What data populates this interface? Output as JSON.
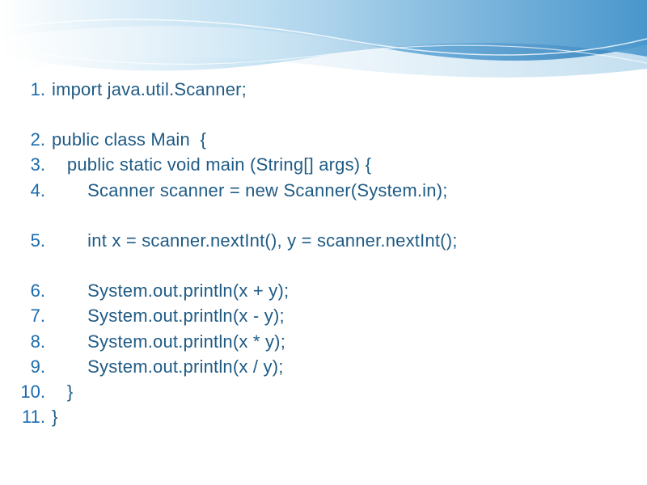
{
  "code_lines": [
    {
      "num": "1.",
      "text": "import java.util.Scanner;",
      "indent": 0
    },
    {
      "num": "",
      "text": "",
      "indent": 0,
      "blank": true
    },
    {
      "num": "2.",
      "text": "public class Main  {",
      "indent": 0
    },
    {
      "num": "3.",
      "text": "   public static void main (String[] args) {",
      "indent": 0
    },
    {
      "num": "4.",
      "text": "       Scanner scanner = new Scanner(System.in);",
      "indent": 0
    },
    {
      "num": "",
      "text": "",
      "indent": 0,
      "blank": true
    },
    {
      "num": "5.",
      "text": "       int x = scanner.nextInt(), y = scanner.nextInt();",
      "indent": 0
    },
    {
      "num": "",
      "text": "",
      "indent": 0,
      "blank": true
    },
    {
      "num": "6.",
      "text": "       System.out.println(x + y);",
      "indent": 0
    },
    {
      "num": "7.",
      "text": "       System.out.println(x - y);",
      "indent": 0
    },
    {
      "num": "8.",
      "text": "       System.out.println(x * y);",
      "indent": 0
    },
    {
      "num": "9.",
      "text": "       System.out.println(x / y);",
      "indent": 0
    },
    {
      "num": "10.",
      "text": "   }",
      "indent": 0
    },
    {
      "num": "11.",
      "text": "}",
      "indent": 0
    }
  ],
  "colors": {
    "wave_dark": "#1a6aad",
    "wave_mid": "#4a9cd4",
    "wave_light": "#a8d4ee",
    "text_code": "#1f5b85",
    "text_number": "#1a6aad"
  }
}
